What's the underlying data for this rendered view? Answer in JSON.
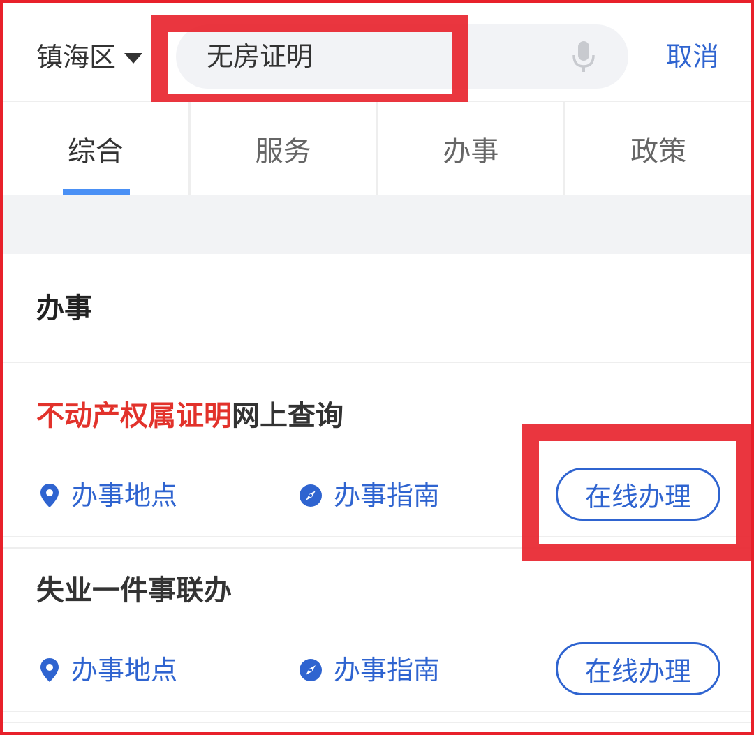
{
  "header": {
    "district": "镇海区",
    "search_value": "无房证明",
    "cancel_label": "取消"
  },
  "tabs": [
    {
      "label": "综合",
      "active": true
    },
    {
      "label": "服务",
      "active": false
    },
    {
      "label": "办事",
      "active": false
    },
    {
      "label": "政策",
      "active": false
    }
  ],
  "section": {
    "title": "办事",
    "items": [
      {
        "title_highlight": "不动产权属证明",
        "title_rest": "网上查询",
        "location_label": "办事地点",
        "guide_label": "办事指南",
        "action_label": "在线办理"
      },
      {
        "title_highlight": "",
        "title_rest": "失业一件事联办",
        "location_label": "办事地点",
        "guide_label": "办事指南",
        "action_label": "在线办理"
      }
    ]
  },
  "icons": {
    "location": "location-pin-icon",
    "guide": "compass-icon",
    "mic": "microphone-icon",
    "dropdown": "caret-down-icon"
  },
  "colors": {
    "accent_blue": "#2f64d0",
    "highlight_red": "#e2322b",
    "annotation_red": "#e8202a",
    "tab_indicator": "#4a90f5"
  }
}
